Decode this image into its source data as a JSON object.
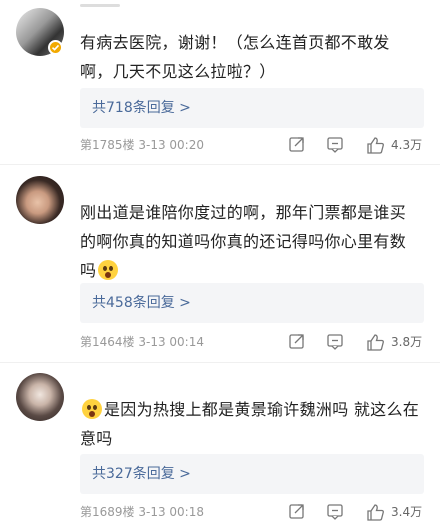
{
  "comments": [
    {
      "text": "有病去医院，谢谢！（怎么连首页都不敢发啊，几天不见这么拉啦？）",
      "replies": "共718条回复 >",
      "meta": "第1785楼 3-13 00:20",
      "likes": "4.3万",
      "verified": true
    },
    {
      "text": "刚出道是谁陪你度过的啊，那年门票都是谁买的啊你真的知道吗你真的还记得吗你心里有数吗",
      "replies": "共458条回复 >",
      "meta": "第1464楼 3-13 00:14",
      "likes": "3.8万"
    },
    {
      "text": "是因为热搜上都是黄景瑜许魏洲吗 就这么在意吗",
      "replies": "共327条回复 >",
      "meta": "第1689楼 3-13 00:18",
      "likes": "3.4万"
    }
  ]
}
